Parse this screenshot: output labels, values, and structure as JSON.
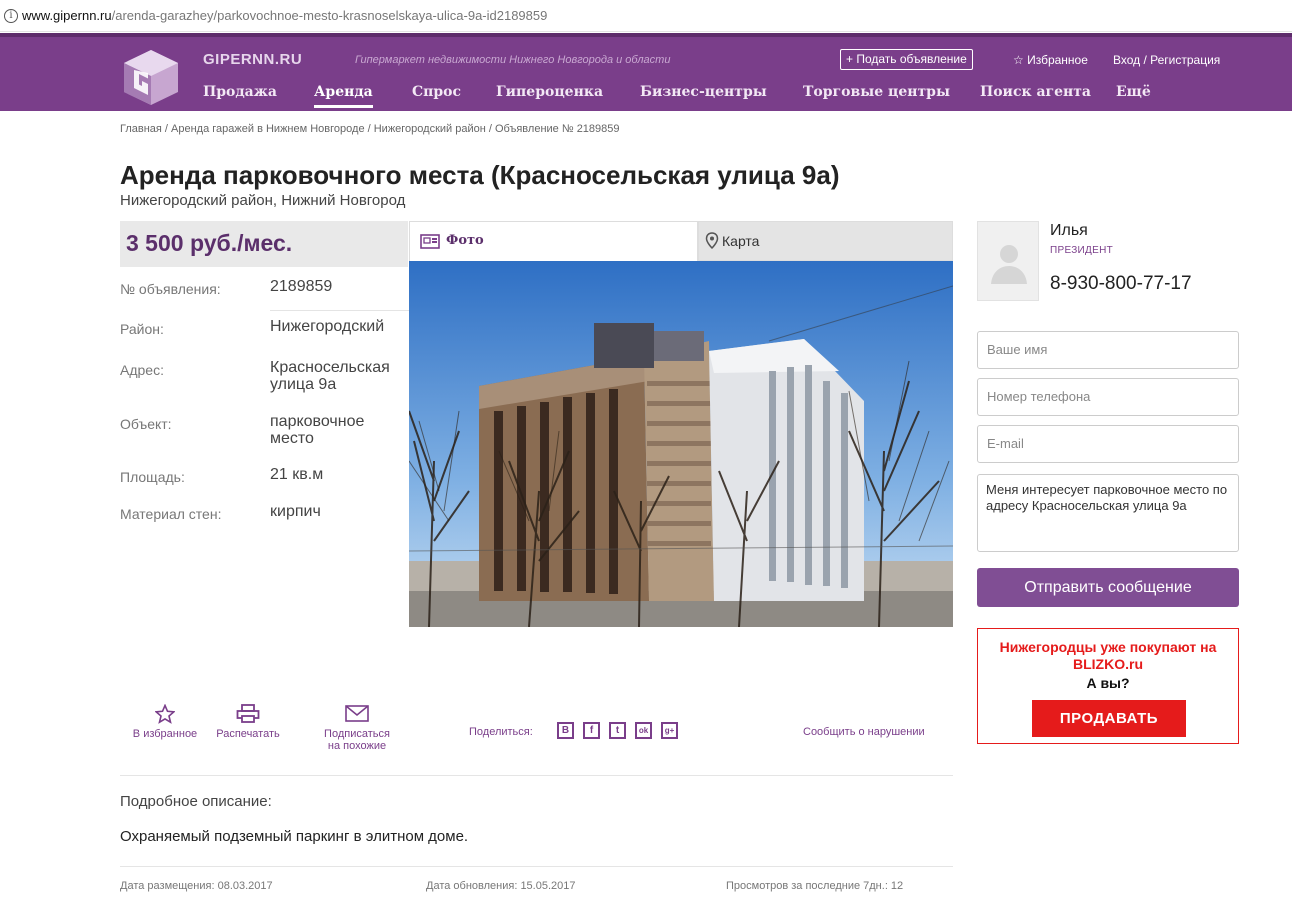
{
  "browser": {
    "url_host": "www.gipernn.ru",
    "url_path": "/arenda-garazhey/parkovochnoe-mesto-krasnoselskaya-ulica-9a-id2189859"
  },
  "header": {
    "brand": "GIPERNN.RU",
    "tagline": "Гипермаркет недвижимости Нижнего Новгорода и области",
    "post_ad": "+ Подать объявление",
    "favorites": "☆ Избранное",
    "login": "Вход / Регистрация",
    "nav": [
      "Продажа",
      "Аренда",
      "Спрос",
      "Гипероценка",
      "Бизнес-центры",
      "Торговые центры",
      "Поиск агента",
      "Ещё"
    ],
    "active_nav": "Аренда"
  },
  "breadcrumb": "Главная / Аренда гаражей в Нижнем Новгороде / Нижегородский район / Объявление № 2189859",
  "listing": {
    "title": "Аренда парковочного места (Красносельская улица 9а)",
    "subtitle": "Нижегородский район, Нижний Новгород",
    "price": "3 500 руб./мес.",
    "details": [
      {
        "key": "№ объявления:",
        "value": "2189859"
      },
      {
        "key": "Район:",
        "value": "Нижегородский"
      },
      {
        "key": "Адрес:",
        "value": "Красносельская улица 9а"
      },
      {
        "key": "Объект:",
        "value": "парковочное место"
      },
      {
        "key": "Площадь:",
        "value": "21 кв.м"
      },
      {
        "key": "Материал стен:",
        "value": "кирпич"
      }
    ]
  },
  "tabs": {
    "photo": "Фото",
    "map": "Карта"
  },
  "actions": {
    "favorite": "В избранное",
    "print": "Распечатать",
    "subscribe_1": "Подписаться",
    "subscribe_2": "на похожие",
    "share_label": "Поделиться:",
    "share_icons": [
      "В",
      "f",
      "t",
      "ok",
      "g+"
    ],
    "report": "Сообщить о нарушении"
  },
  "description": {
    "heading": "Подробное описание:",
    "text": "Охраняемый подземный паркинг в элитном доме."
  },
  "meta": {
    "posted": "Дата размещения: 08.03.2017",
    "updated": "Дата обновления: 15.05.2017",
    "views": "Просмотров за последние 7дн.: 12"
  },
  "agent": {
    "name": "Илья",
    "role": "ПРЕЗИДЕНТ",
    "phone": "8-930-800-77-17"
  },
  "form": {
    "name_placeholder": "Ваше имя",
    "phone_placeholder": "Номер телефона",
    "email_placeholder": "E-mail",
    "message": "Меня интересует парковочное место по адресу Красносельская улица 9а",
    "send": "Отправить сообщение"
  },
  "ad": {
    "line1": "Нижегородцы уже покупают на BLIZKO.ru",
    "line2": "А вы?",
    "button": "ПРОДАВАТЬ"
  },
  "colors": {
    "brand_purple": "#7a3e8a",
    "ad_red": "#e51b1b"
  }
}
